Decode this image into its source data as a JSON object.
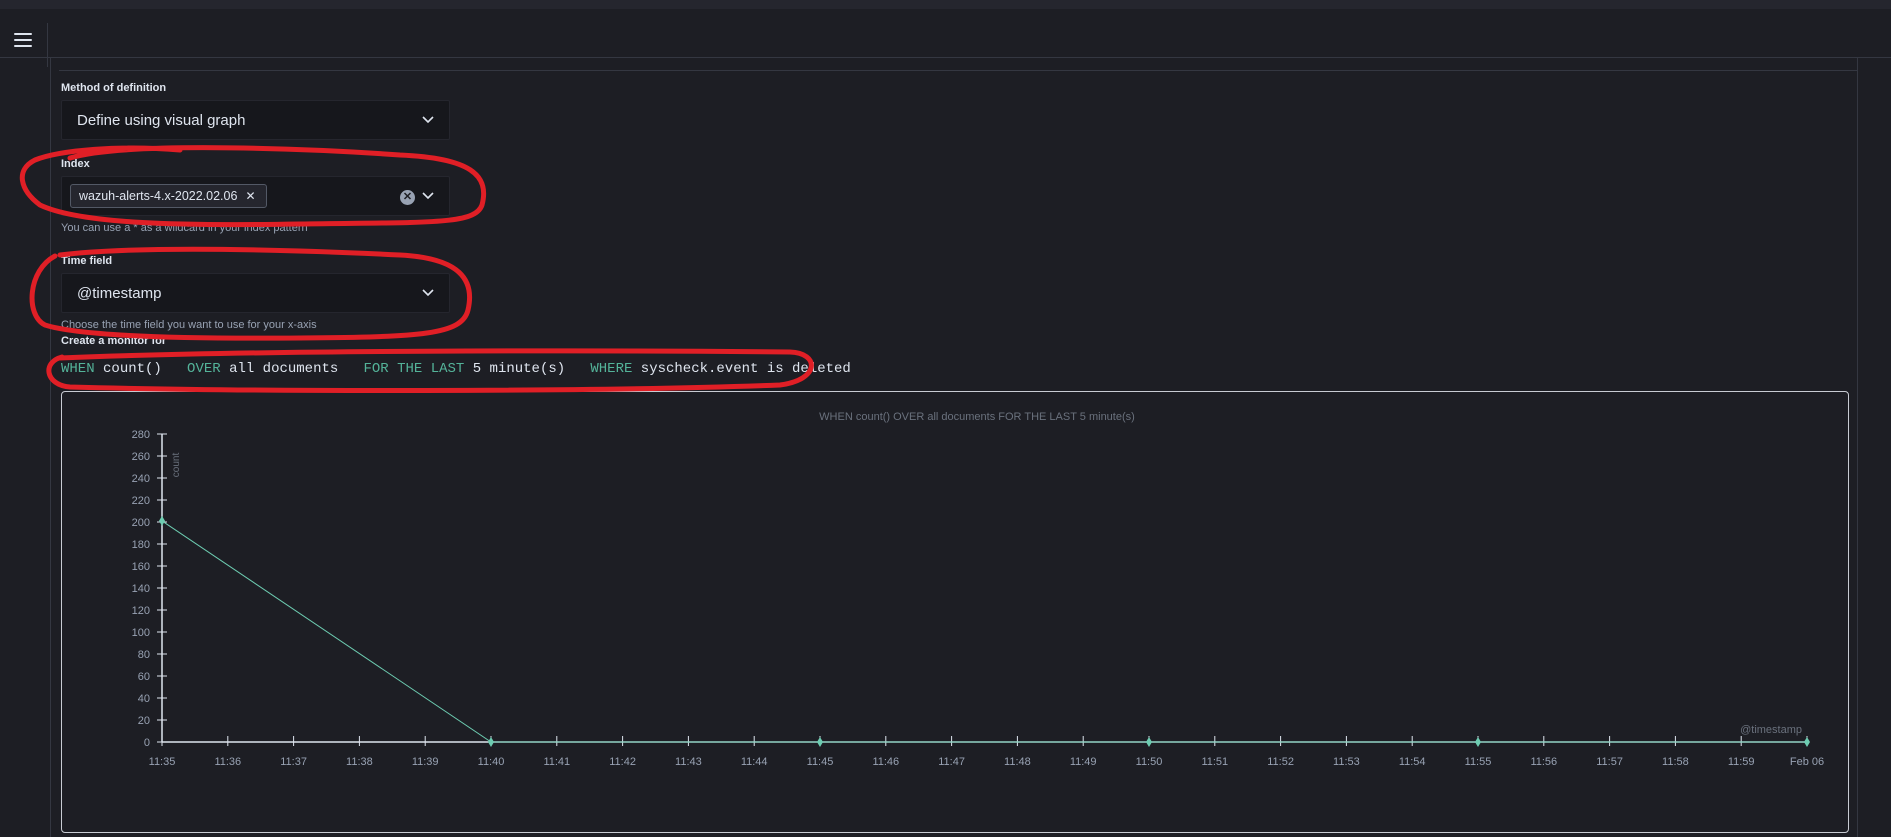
{
  "form": {
    "method_label": "Method of definition",
    "method_value": "Define using visual graph",
    "index_label": "Index",
    "index_pill": "wazuh-alerts-4.x-2022.02.06",
    "index_help": "You can use a * as a wildcard in your index pattern",
    "time_label": "Time field",
    "time_value": "@timestamp",
    "time_help": "Choose the time field you want to use for your x-axis",
    "monitor_label": "Create a monitor for"
  },
  "expression": {
    "when_kw": "WHEN",
    "when_val": "count()",
    "over_kw": "OVER",
    "over_val": "all documents",
    "for_kw": "FOR THE LAST",
    "for_val": "5 minute(s)",
    "where_kw": "WHERE",
    "where_val": "syscheck.event is deleted"
  },
  "colors": {
    "accent_keyword": "#54b399",
    "series_line": "#6dccb1",
    "annotation_red": "#e01f26"
  },
  "chart_data": {
    "type": "line",
    "title": "WHEN count() OVER all documents FOR THE LAST 5 minute(s)",
    "xlabel": "@timestamp",
    "ylabel": "count",
    "ylim": [
      0,
      280
    ],
    "yticks": [
      0,
      20,
      40,
      60,
      80,
      100,
      120,
      140,
      160,
      180,
      200,
      220,
      240,
      260,
      280
    ],
    "xticks": [
      "11:35",
      "11:36",
      "11:37",
      "11:38",
      "11:39",
      "11:40",
      "11:41",
      "11:42",
      "11:43",
      "11:44",
      "11:45",
      "11:46",
      "11:47",
      "11:48",
      "11:49",
      "11:50",
      "11:51",
      "11:52",
      "11:53",
      "11:54",
      "11:55",
      "11:56",
      "11:57",
      "11:58",
      "11:59",
      "Feb 06"
    ],
    "series": [
      {
        "x": [
          "11:35",
          "11:40",
          "11:45",
          "11:50",
          "11:55",
          "Feb 06"
        ],
        "values": [
          201,
          0,
          0,
          0,
          0,
          0
        ]
      }
    ]
  }
}
